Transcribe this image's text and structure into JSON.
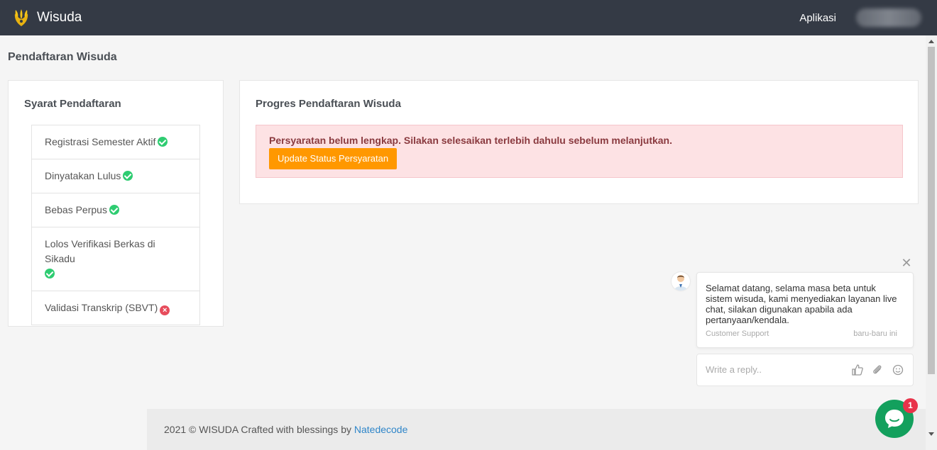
{
  "header": {
    "brand": "Wisuda",
    "nav_link": "Aplikasi"
  },
  "page": {
    "title": "Pendaftaran Wisuda"
  },
  "requirements": {
    "title": "Syarat Pendaftaran",
    "items": [
      {
        "label": "Registrasi Semester Aktif",
        "status": "ok"
      },
      {
        "label": "Dinyatakan Lulus",
        "status": "ok"
      },
      {
        "label": "Bebas Perpus",
        "status": "ok"
      },
      {
        "label": "Lolos Verifikasi Berkas di Sikadu",
        "status": "ok"
      },
      {
        "label": "Validasi Transkrip (SBVT)",
        "status": "fail"
      }
    ]
  },
  "progress": {
    "title": "Progres Pendaftaran Wisuda",
    "alert_text": "Persyaratan belum lengkap. Silakan selesaikan terlebih dahulu sebelum melanjutkan.",
    "button_label": "Update Status Persyaratan"
  },
  "footer": {
    "text": "2021 © WISUDA Crafted with blessings by",
    "link": "Natedecode"
  },
  "chat": {
    "message": "Selamat datang, selama masa beta untuk sistem wisuda, kami menyediakan layanan live chat, silakan digunakan apabila ada pertanyaan/kendala.",
    "author": "Customer Support",
    "time": "baru-baru ini",
    "reply_placeholder": "Write a reply..",
    "badge_count": "1"
  },
  "colors": {
    "topbar": "#343a45",
    "accent_button": "#ff9800",
    "alert_bg": "#fde2e4",
    "ok": "#2ecc71",
    "fail": "#e74c5c",
    "chat_launcher": "#13a05d"
  }
}
